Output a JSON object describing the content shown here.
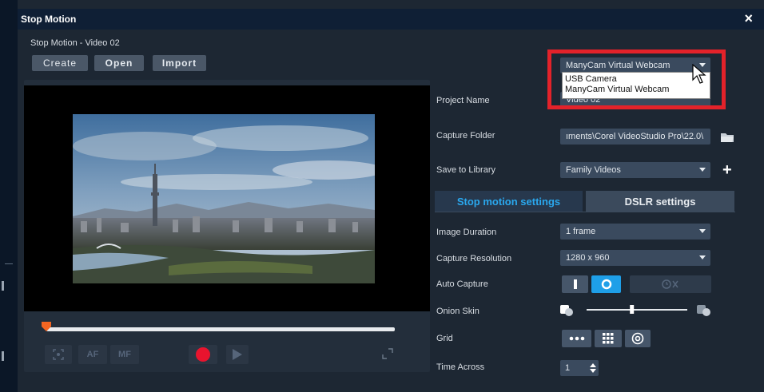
{
  "window": {
    "title": "Stop Motion",
    "close_symbol": "×",
    "project_title": "Stop Motion - Video 02"
  },
  "toolbar": {
    "create_label": "Create",
    "open_label": "Open",
    "import_label": "Import"
  },
  "camera": {
    "selected": "ManyCam Virtual Webcam",
    "options": [
      "USB Camera",
      "ManyCam Virtual Webcam"
    ]
  },
  "fields": {
    "project_name_label": "Project Name",
    "project_name_value": "Video 02",
    "capture_folder_label": "Capture Folder",
    "capture_folder_value": "ıments\\Corel VideoStudio Pro\\22.0\\",
    "save_library_label": "Save to Library",
    "save_library_value": "Family Videos"
  },
  "tabs": {
    "stop_motion": "Stop motion settings",
    "dslr": "DSLR settings"
  },
  "settings": {
    "image_duration_label": "Image Duration",
    "image_duration_value": "1 frame",
    "capture_resolution_label": "Capture Resolution",
    "capture_resolution_value": "1280 x 960",
    "auto_capture_label": "Auto Capture",
    "onion_skin_label": "Onion Skin",
    "onion_skin_level": 0.45,
    "grid_label": "Grid",
    "time_across_label": "Time Across",
    "time_across_value": "1"
  },
  "controls": {
    "af_label": "AF",
    "mf_label": "MF"
  },
  "colors": {
    "accent": "#1e9fe8",
    "record": "#e8142e",
    "highlight": "#e3222a",
    "scrub_handle": "#f26522"
  }
}
